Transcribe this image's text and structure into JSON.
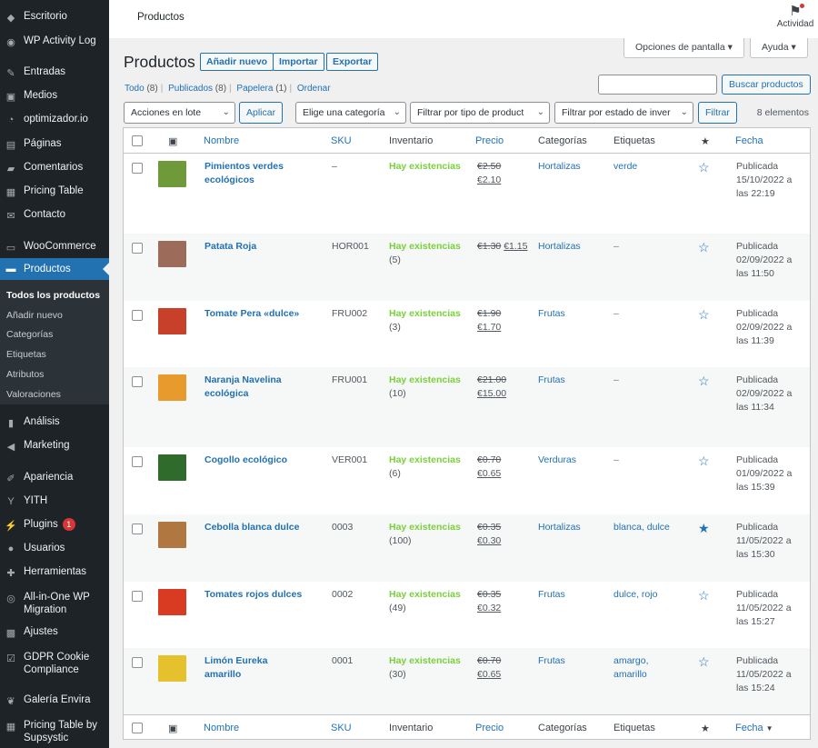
{
  "sidebar": {
    "items": [
      {
        "icon": "dashboard-icon",
        "glyph": "◆",
        "label": "Escritorio"
      },
      {
        "icon": "shield-icon",
        "glyph": "◉",
        "label": "WP Activity Log"
      },
      {
        "icon": "pin-icon",
        "glyph": "✎",
        "label": "Entradas"
      },
      {
        "icon": "media-icon",
        "glyph": "▣",
        "label": "Medios"
      },
      {
        "icon": "gauge-icon",
        "glyph": "◔",
        "label": "optimizador.io"
      },
      {
        "icon": "pages-icon",
        "glyph": "▤",
        "label": "Páginas"
      },
      {
        "icon": "comment-icon",
        "glyph": "▰",
        "label": "Comentarios"
      },
      {
        "icon": "table-icon",
        "glyph": "▦",
        "label": "Pricing Table"
      },
      {
        "icon": "mail-icon",
        "glyph": "✉",
        "label": "Contacto"
      },
      {
        "icon": "woo-icon",
        "glyph": "▭",
        "label": "WooCommerce"
      },
      {
        "icon": "products-icon",
        "glyph": "▬",
        "label": "Productos"
      },
      {
        "icon": "chart-icon",
        "glyph": "▮",
        "label": "Análisis"
      },
      {
        "icon": "megaphone-icon",
        "glyph": "◀",
        "label": "Marketing"
      },
      {
        "icon": "brush-icon",
        "glyph": "✐",
        "label": "Apariencia"
      },
      {
        "icon": "yith-icon",
        "glyph": "Y",
        "label": "YITH"
      },
      {
        "icon": "plugin-icon",
        "glyph": "⚡",
        "label": "Plugins",
        "badge": "1"
      },
      {
        "icon": "users-icon",
        "glyph": "●",
        "label": "Usuarios"
      },
      {
        "icon": "wrench-icon",
        "glyph": "✚",
        "label": "Herramientas"
      },
      {
        "icon": "migration-icon",
        "glyph": "◎",
        "label": "All-in-One WP",
        "label2": "Migration"
      },
      {
        "icon": "settings-icon",
        "glyph": "▩",
        "label": "Ajustes"
      },
      {
        "icon": "cookie-icon",
        "glyph": "☑",
        "label": "GDPR Cookie",
        "label2": "Compliance"
      },
      {
        "icon": "leaf-icon",
        "glyph": "❦",
        "label": "Galería Envira"
      },
      {
        "icon": "pricing-icon",
        "glyph": "▦",
        "label": "Pricing Table by",
        "label2": "Supsystic"
      }
    ],
    "submenu": [
      "Todos los productos",
      "Añadir nuevo",
      "Categorías",
      "Etiquetas",
      "Atributos",
      "Valoraciones"
    ]
  },
  "topbar": {
    "title": "Productos",
    "activity": "Actividad"
  },
  "screen_options": "Opciones de pantalla",
  "help": "Ayuda",
  "page": {
    "heading": "Productos",
    "add_new": "Añadir nuevo",
    "import": "Importar",
    "export": "Exportar"
  },
  "views": {
    "all": "Todo",
    "all_count": "(8)",
    "published": "Publicados",
    "published_count": "(8)",
    "trash": "Papelera",
    "trash_count": "(1)",
    "sort": "Ordenar"
  },
  "search": {
    "button": "Buscar productos",
    "value": ""
  },
  "filters": {
    "bulk": "Acciones en lote",
    "apply": "Aplicar",
    "category": "Elige una categoría",
    "type": "Filtrar por tipo de product",
    "stock": "Filtrar por estado de inver",
    "filter": "Filtrar",
    "items_count": "8 elementos"
  },
  "columns": {
    "name": "Nombre",
    "sku": "SKU",
    "stock": "Inventario",
    "price": "Precio",
    "categories": "Categorías",
    "tags": "Etiquetas",
    "date": "Fecha",
    "date_sort": "▼"
  },
  "products": [
    {
      "name": "Pimientos verdes ecológicos",
      "sku": "–",
      "stock": "Hay existencias",
      "qty": "",
      "old": "€2.50",
      "new": "€2.10",
      "cat": "Hortalizas",
      "tags": "verde",
      "featured": false,
      "date1": "Publicada",
      "date2": "15/10/2022 a",
      "date3": "las 22:19",
      "thumb": "#6f9a3a"
    },
    {
      "name": "Patata Roja",
      "sku": "HOR001",
      "stock": "Hay existencias",
      "qty": "(5)",
      "old": "€1.30",
      "new": "€1.15",
      "cat": "Hortalizas",
      "tags": "–",
      "featured": false,
      "date1": "Publicada",
      "date2": "02/09/2022 a",
      "date3": "las 11:50",
      "thumb": "#9c6b5a"
    },
    {
      "name": "Tomate Pera «dulce»",
      "sku": "FRU002",
      "stock": "Hay existencias",
      "qty": "(3)",
      "old": "€1.90",
      "new": "€1.70",
      "cat": "Frutas",
      "tags": "–",
      "featured": false,
      "date1": "Publicada",
      "date2": "02/09/2022 a",
      "date3": "las 11:39",
      "thumb": "#c8402a"
    },
    {
      "name": "Naranja Navelina ecológica",
      "sku": "FRU001",
      "stock": "Hay existencias",
      "qty": "(10)",
      "old": "€21.00",
      "new": "€15.00",
      "cat": "Frutas",
      "tags": "–",
      "featured": false,
      "date1": "Publicada",
      "date2": "02/09/2022 a",
      "date3": "las 11:34",
      "thumb": "#e89a2c"
    },
    {
      "name": "Cogollo ecológico",
      "sku": "VER001",
      "stock": "Hay existencias",
      "qty": "(6)",
      "old": "€0.70",
      "new": "€0.65",
      "cat": "Verduras",
      "tags": "–",
      "featured": false,
      "date1": "Publicada",
      "date2": "01/09/2022 a",
      "date3": "las 15:39",
      "thumb": "#2f6b2a"
    },
    {
      "name": "Cebolla blanca dulce",
      "sku": "0003",
      "stock": "Hay existencias",
      "qty": "(100)",
      "old": "€0.35",
      "new": "€0.30",
      "cat": "Hortalizas",
      "tags": "blanca, dulce",
      "featured": true,
      "date1": "Publicada",
      "date2": "11/05/2022 a",
      "date3": "las 15:30",
      "thumb": "#b07840"
    },
    {
      "name": "Tomates rojos dulces",
      "sku": "0002",
      "stock": "Hay existencias",
      "qty": "(49)",
      "old": "€0.35",
      "new": "€0.32",
      "cat": "Frutas",
      "tags": "dulce, rojo",
      "featured": false,
      "date1": "Publicada",
      "date2": "11/05/2022 a",
      "date3": "las 15:27",
      "thumb": "#d83a22"
    },
    {
      "name": "Limón Eureka amarillo",
      "sku": "0001",
      "stock": "Hay existencias",
      "qty": "(30)",
      "old": "€0.70",
      "new": "€0.65",
      "cat": "Frutas",
      "tags": "amargo, amarillo",
      "featured": false,
      "date1": "Publicada",
      "date2": "11/05/2022 a",
      "date3": "las 15:24",
      "thumb": "#e6c12e"
    }
  ]
}
